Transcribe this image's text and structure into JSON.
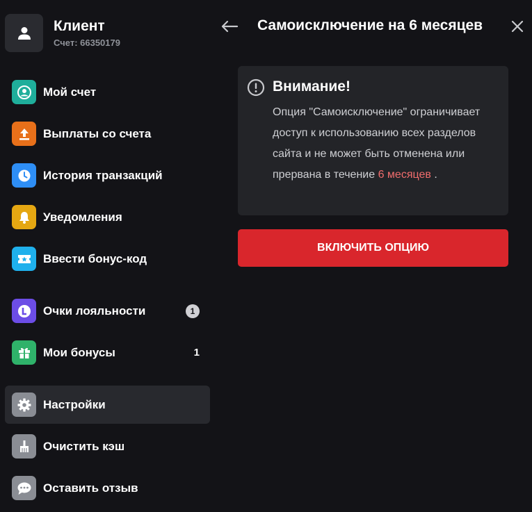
{
  "profile": {
    "name": "Клиент",
    "account": "Счет: 66350179"
  },
  "menu": [
    {
      "label": "Мой счет",
      "icon": "account-circle-icon",
      "color": "#1fae9b"
    },
    {
      "label": "Выплаты со счета",
      "icon": "upload-icon",
      "color": "#e8701a"
    },
    {
      "label": "История транзакций",
      "icon": "clock-icon",
      "color": "#2e8ef5"
    },
    {
      "label": "Уведомления",
      "icon": "bell-icon",
      "color": "#e5a712"
    },
    {
      "label": "Ввести бонус-код",
      "icon": "ticket-star-icon",
      "color": "#1fb0ec"
    },
    {
      "label": "Очки лояльности",
      "icon": "loyalty-l-icon",
      "color": "#6c4de6",
      "count": "1"
    },
    {
      "label": "Мои бонусы",
      "icon": "gift-icon",
      "color": "#2fb26a",
      "count": "1"
    },
    {
      "label": "Настройки",
      "icon": "gear-icon",
      "color": "#8a8d94"
    },
    {
      "label": "Очистить кэш",
      "icon": "broom-icon",
      "color": "#8a8d94"
    },
    {
      "label": "Оставить отзыв",
      "icon": "chat-bubble-icon",
      "color": "#8a8d94"
    }
  ],
  "header": {
    "title": "Самоисключение на 6 месяцев"
  },
  "warning": {
    "title": "Внимание!",
    "text_before": "Опция \"Самоисключение\" ограничивает доступ к использованию всех разделов сайта и не может быть отменена или прервана в течение ",
    "highlight": "6 месяцев",
    "text_after": " ."
  },
  "enable_button": "ВКЛЮЧИТЬ ОПЦИЮ",
  "colors": {
    "background": "#131317",
    "panel": "#232428",
    "accent_red": "#d9262c",
    "highlight": "#f16d6d"
  }
}
